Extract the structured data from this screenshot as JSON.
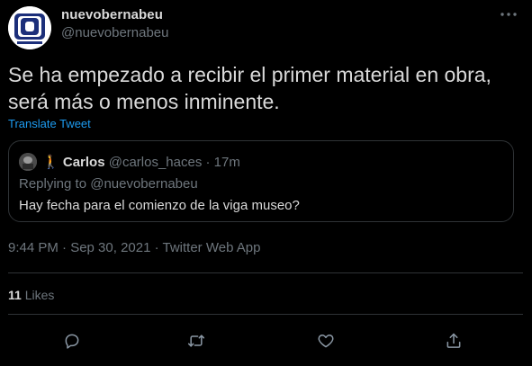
{
  "author": {
    "name": "nuevobernabeu",
    "handle": "@nuevobernabeu"
  },
  "tweet": {
    "text_line1": "Se ha empezado a recibir el primer material en obra,",
    "text_line2": "será más o menos inminente.",
    "translate_label": "Translate Tweet"
  },
  "quote": {
    "emoji": "🚶",
    "name": "Carlos",
    "handle": "@carlos_haces",
    "separator": "·",
    "time": "17m",
    "replying_to": "Replying to @nuevobernabeu",
    "text": "Hay fecha para el comienzo de la viga museo?"
  },
  "meta": {
    "timestamp": "9:44 PM · Sep 30, 2021 · Twitter Web App"
  },
  "stats": {
    "likes_count": "11",
    "likes_label": "Likes"
  },
  "colors": {
    "background": "#000000",
    "text": "#d9d9d9",
    "muted": "#6e767d",
    "link": "#1d9bf0",
    "border": "#2f3336"
  },
  "icons": {
    "reply": "reply-icon",
    "retweet": "retweet-icon",
    "like": "heart-icon",
    "share": "share-icon",
    "more": "more-icon"
  }
}
